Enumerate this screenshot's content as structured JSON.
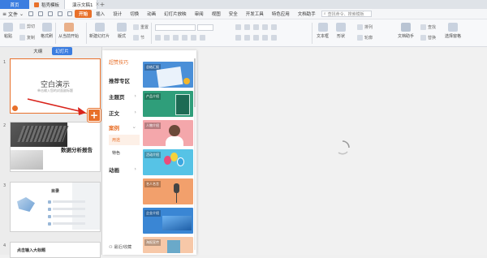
{
  "titlebar": {
    "home": "首页",
    "tabs": [
      {
        "label": "稻壳模板",
        "color": "#e8702a",
        "active": false
      },
      {
        "label": "演示文稿1",
        "color": "#e8702a",
        "active": true
      }
    ],
    "new_tab": "+"
  },
  "menubar": {
    "file": "文件",
    "items": [
      "开始",
      "插入",
      "设计",
      "切换",
      "动画",
      "幻灯片放映",
      "审阅",
      "视图",
      "安全",
      "开发工具",
      "特色应用",
      "文档助手"
    ],
    "active_index": 0,
    "search_placeholder": "查找命令、搜索模板"
  },
  "ribbon": {
    "paste": "粘贴",
    "cut": "剪切",
    "copy": "复制",
    "format_painter": "格式刷",
    "from_start": "从当前开始",
    "new_slide": "新建幻灯片",
    "layout": "版式",
    "section": "节",
    "reset": "重置",
    "textbox": "文本框",
    "shape": "形状",
    "arrange": "排列",
    "outline": "轮廓",
    "doc_helper": "文档助手",
    "find": "查找",
    "replace": "替换",
    "select_pane": "选择窗格"
  },
  "leftpanel": {
    "tabs": [
      "大纲",
      "幻灯片"
    ],
    "active_tab": 1,
    "slides": [
      {
        "num": "1",
        "title": "空白演示",
        "subtitle": "单击输入您的封面副标题"
      },
      {
        "num": "2",
        "title": "数据分析报告"
      },
      {
        "num": "3",
        "title": "目录"
      },
      {
        "num": "4",
        "title": "点击输入大标题"
      }
    ]
  },
  "template_panel": {
    "header": "超赞技巧",
    "nav": [
      {
        "label": "推荐专区",
        "chevron": ""
      },
      {
        "label": "主题页",
        "chevron": "›"
      },
      {
        "label": "正文",
        "chevron": "›"
      },
      {
        "label": "案例",
        "chevron": "⌄"
      },
      {
        "label": "动画",
        "chevron": "›"
      }
    ],
    "sub": [
      {
        "label": "用途",
        "selected": true
      },
      {
        "label": "特色",
        "selected": false
      }
    ],
    "footer": "最近/收藏",
    "thumbnails": [
      {
        "label": "总结汇报",
        "color": "#4a8fd8"
      },
      {
        "label": "产品介绍",
        "color": "#2f9e7a"
      },
      {
        "label": "人物介绍",
        "color": "#f4a7ab"
      },
      {
        "label": "活动介绍",
        "color": "#56c3e6"
      },
      {
        "label": "名人名言",
        "color": "#f2a06c"
      },
      {
        "label": "企业介绍",
        "color": "#3a86d4"
      },
      {
        "label": "海报宣传",
        "color": "#f7c8a8"
      }
    ]
  }
}
